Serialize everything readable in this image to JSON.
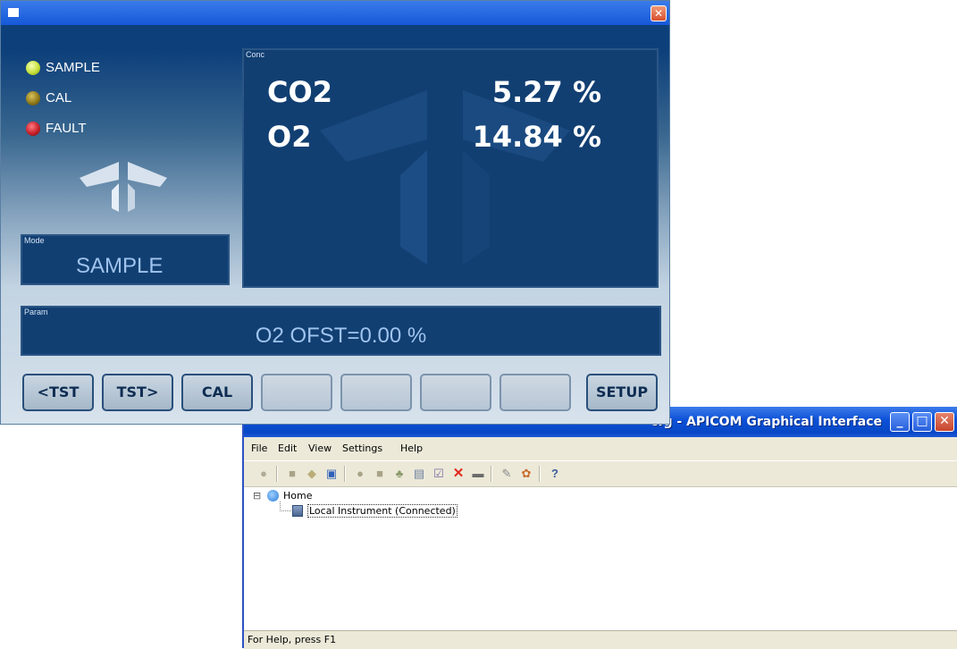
{
  "apicom": {
    "title": "cfg - APICOM Graphical Interface",
    "window_buttons": {
      "minimize": "_",
      "maximize": "□",
      "close": "✕"
    },
    "menu": [
      "File",
      "Edit",
      "View",
      "Settings",
      "Help"
    ],
    "tree": {
      "expander": "⊟",
      "root": "Home",
      "child": "Local Instrument (Connected)"
    },
    "status": "For Help, press F1"
  },
  "instrument": {
    "close_glyph": "✕",
    "leds": [
      {
        "label": "SAMPLE",
        "color": "#c6e23a"
      },
      {
        "label": "CAL",
        "color": "#8a7416"
      },
      {
        "label": "FAULT",
        "color": "#c8202a"
      }
    ],
    "mode": {
      "caption": "Mode",
      "value": "SAMPLE"
    },
    "conc": {
      "caption": "Conc",
      "rows": [
        {
          "name": "CO2",
          "value": "5.27 %"
        },
        {
          "name": "O2",
          "value": "14.84 %"
        }
      ]
    },
    "param": {
      "caption": "Param",
      "value": "O2 OFST=0.00 %"
    },
    "buttons": [
      "<TST",
      "TST>",
      "CAL",
      "",
      "",
      "",
      "",
      "SETUP"
    ]
  },
  "colors": {
    "panel": "#123f72",
    "led_sample": "#c6e23a",
    "led_cal": "#8a7416",
    "led_fault": "#c8202a"
  }
}
